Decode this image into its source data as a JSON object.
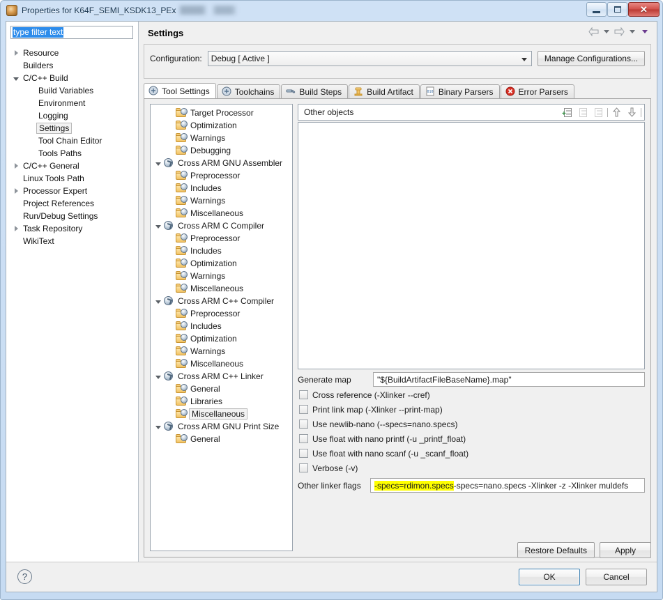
{
  "window": {
    "title": "Properties for K64F_SEMI_KSDK13_PEx",
    "icon": "project-properties-icon",
    "controls": {
      "minimize": "minimize-button",
      "maximize": "maximize-button",
      "close_glyph": "✕"
    }
  },
  "filter": {
    "value": "type filter text"
  },
  "nav_tree": [
    {
      "label": "Resource",
      "indent": 0,
      "twisty": "collapsed",
      "selected": false
    },
    {
      "label": "Builders",
      "indent": 0,
      "twisty": "none",
      "selected": false
    },
    {
      "label": "C/C++ Build",
      "indent": 0,
      "twisty": "expanded",
      "selected": false
    },
    {
      "label": "Build Variables",
      "indent": 1,
      "twisty": "none",
      "selected": false
    },
    {
      "label": "Environment",
      "indent": 1,
      "twisty": "none",
      "selected": false
    },
    {
      "label": "Logging",
      "indent": 1,
      "twisty": "none",
      "selected": false
    },
    {
      "label": "Settings",
      "indent": 1,
      "twisty": "none",
      "selected": true
    },
    {
      "label": "Tool Chain Editor",
      "indent": 1,
      "twisty": "none",
      "selected": false
    },
    {
      "label": "Tools Paths",
      "indent": 1,
      "twisty": "none",
      "selected": false
    },
    {
      "label": "C/C++ General",
      "indent": 0,
      "twisty": "collapsed",
      "selected": false
    },
    {
      "label": "Linux Tools Path",
      "indent": 0,
      "twisty": "none",
      "selected": false
    },
    {
      "label": "Processor Expert",
      "indent": 0,
      "twisty": "collapsed",
      "selected": false
    },
    {
      "label": "Project References",
      "indent": 0,
      "twisty": "none",
      "selected": false
    },
    {
      "label": "Run/Debug Settings",
      "indent": 0,
      "twisty": "none",
      "selected": false
    },
    {
      "label": "Task Repository",
      "indent": 0,
      "twisty": "collapsed",
      "selected": false
    },
    {
      "label": "WikiText",
      "indent": 0,
      "twisty": "none",
      "selected": false
    }
  ],
  "page": {
    "title": "Settings",
    "nav_back": "back-arrow",
    "nav_forward": "forward-arrow"
  },
  "configuration": {
    "label": "Configuration:",
    "value": "Debug  [ Active ]",
    "manage_button": "Manage Configurations..."
  },
  "tabs": [
    {
      "label": "Tool Settings",
      "icon": "gear-icon",
      "active": true
    },
    {
      "label": "Toolchains",
      "icon": "gear-icon",
      "active": false
    },
    {
      "label": "Build Steps",
      "icon": "hammer-icon",
      "active": false
    },
    {
      "label": "Build Artifact",
      "icon": "artifact-icon",
      "active": false
    },
    {
      "label": "Binary Parsers",
      "icon": "binary-file-icon",
      "active": false
    },
    {
      "label": "Error Parsers",
      "icon": "error-icon",
      "active": false
    }
  ],
  "tool_tree": [
    {
      "label": "Target Processor",
      "indent": 1,
      "twisty": "none",
      "icon": "folder",
      "selected": false
    },
    {
      "label": "Optimization",
      "indent": 1,
      "twisty": "none",
      "icon": "folder",
      "selected": false
    },
    {
      "label": "Warnings",
      "indent": 1,
      "twisty": "none",
      "icon": "folder",
      "selected": false
    },
    {
      "label": "Debugging",
      "indent": 1,
      "twisty": "none",
      "icon": "folder",
      "selected": false
    },
    {
      "label": "Cross ARM GNU Assembler",
      "indent": 0,
      "twisty": "expanded",
      "icon": "gear",
      "selected": false
    },
    {
      "label": "Preprocessor",
      "indent": 1,
      "twisty": "none",
      "icon": "folder",
      "selected": false
    },
    {
      "label": "Includes",
      "indent": 1,
      "twisty": "none",
      "icon": "folder",
      "selected": false
    },
    {
      "label": "Warnings",
      "indent": 1,
      "twisty": "none",
      "icon": "folder",
      "selected": false
    },
    {
      "label": "Miscellaneous",
      "indent": 1,
      "twisty": "none",
      "icon": "folder",
      "selected": false
    },
    {
      "label": "Cross ARM C Compiler",
      "indent": 0,
      "twisty": "expanded",
      "icon": "gear",
      "selected": false
    },
    {
      "label": "Preprocessor",
      "indent": 1,
      "twisty": "none",
      "icon": "folder",
      "selected": false
    },
    {
      "label": "Includes",
      "indent": 1,
      "twisty": "none",
      "icon": "folder",
      "selected": false
    },
    {
      "label": "Optimization",
      "indent": 1,
      "twisty": "none",
      "icon": "folder",
      "selected": false
    },
    {
      "label": "Warnings",
      "indent": 1,
      "twisty": "none",
      "icon": "folder",
      "selected": false
    },
    {
      "label": "Miscellaneous",
      "indent": 1,
      "twisty": "none",
      "icon": "folder",
      "selected": false
    },
    {
      "label": "Cross ARM C++ Compiler",
      "indent": 0,
      "twisty": "expanded",
      "icon": "gear",
      "selected": false
    },
    {
      "label": "Preprocessor",
      "indent": 1,
      "twisty": "none",
      "icon": "folder",
      "selected": false
    },
    {
      "label": "Includes",
      "indent": 1,
      "twisty": "none",
      "icon": "folder",
      "selected": false
    },
    {
      "label": "Optimization",
      "indent": 1,
      "twisty": "none",
      "icon": "folder",
      "selected": false
    },
    {
      "label": "Warnings",
      "indent": 1,
      "twisty": "none",
      "icon": "folder",
      "selected": false
    },
    {
      "label": "Miscellaneous",
      "indent": 1,
      "twisty": "none",
      "icon": "folder",
      "selected": false
    },
    {
      "label": "Cross ARM C++ Linker",
      "indent": 0,
      "twisty": "expanded",
      "icon": "gear",
      "selected": false
    },
    {
      "label": "General",
      "indent": 1,
      "twisty": "none",
      "icon": "folder",
      "selected": false
    },
    {
      "label": "Libraries",
      "indent": 1,
      "twisty": "none",
      "icon": "folder",
      "selected": false
    },
    {
      "label": "Miscellaneous",
      "indent": 1,
      "twisty": "none",
      "icon": "folder",
      "selected": true
    },
    {
      "label": "Cross ARM GNU Print Size",
      "indent": 0,
      "twisty": "expanded",
      "icon": "gear",
      "selected": false
    },
    {
      "label": "General",
      "indent": 1,
      "twisty": "none",
      "icon": "folder",
      "selected": false
    }
  ],
  "other_objects": {
    "label": "Other objects",
    "toolbar": [
      {
        "name": "add-object-icon",
        "enabled": true
      },
      {
        "name": "delete-object-icon",
        "enabled": false
      },
      {
        "name": "edit-object-icon",
        "enabled": false
      },
      {
        "name": "move-up-icon",
        "enabled": true
      },
      {
        "name": "move-down-icon",
        "enabled": true
      }
    ],
    "items": []
  },
  "linker_options": {
    "generate_map": {
      "label": "Generate map",
      "value": "\"${BuildArtifactFileBaseName}.map\""
    },
    "checkboxes": [
      {
        "label": "Cross reference (-Xlinker --cref)",
        "checked": false
      },
      {
        "label": "Print link map (-Xlinker --print-map)",
        "checked": false
      },
      {
        "label": "Use newlib-nano (--specs=nano.specs)",
        "checked": false
      },
      {
        "label": "Use float with nano printf (-u _printf_float)",
        "checked": false
      },
      {
        "label": "Use float with nano scanf (-u _scanf_float)",
        "checked": false
      },
      {
        "label": "Verbose (-v)",
        "checked": false
      }
    ],
    "other_linker_flags": {
      "label": "Other linker flags",
      "highlighted": "-specs=rdimon.specs ",
      "rest": "-specs=nano.specs -Xlinker -z -Xlinker muldefs",
      "highlight_color": "#ffff00"
    }
  },
  "buttons": {
    "restore_defaults": "Restore Defaults",
    "apply": "Apply",
    "ok": "OK",
    "cancel": "Cancel",
    "help": "?"
  }
}
